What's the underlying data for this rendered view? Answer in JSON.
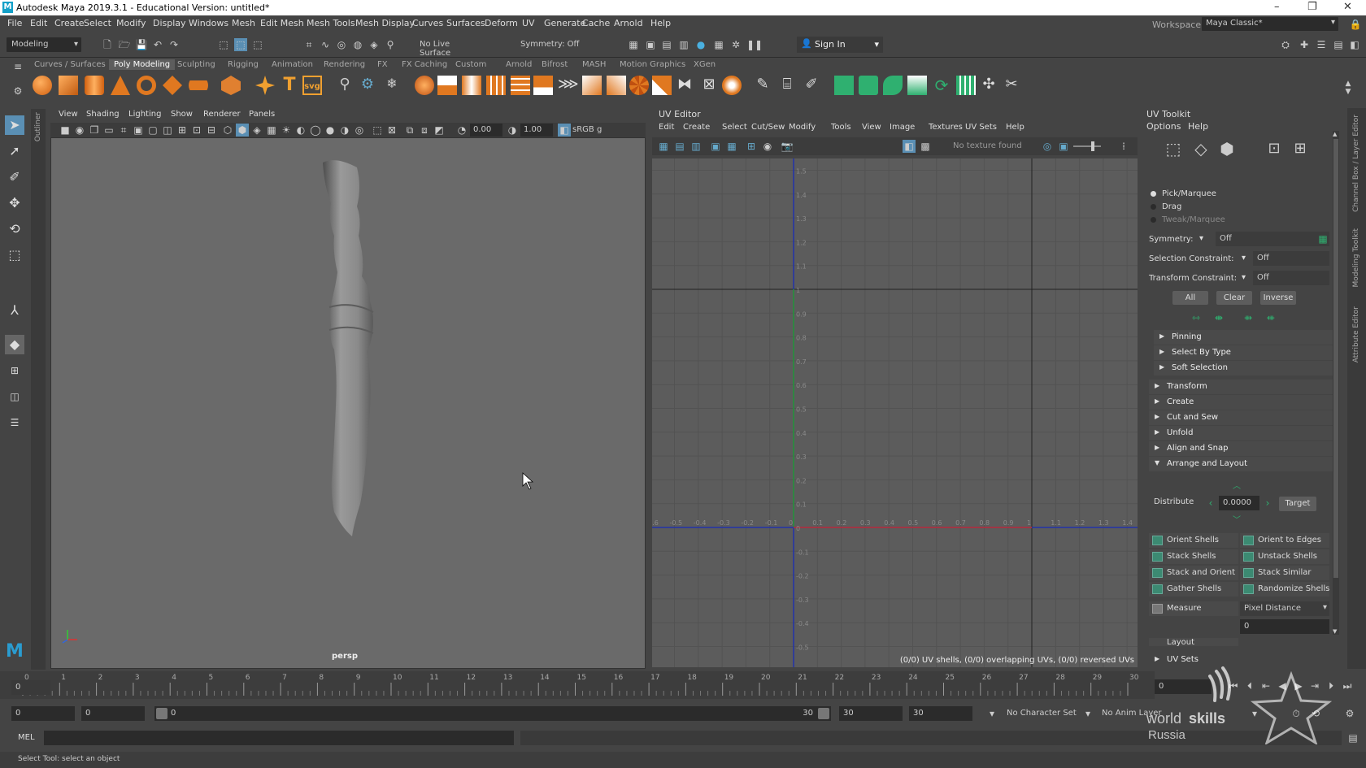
{
  "window": {
    "title": "Autodesk Maya 2019.3.1 - Educational Version: untitled*",
    "logo": "M"
  },
  "menubar": {
    "items": [
      "File",
      "Edit",
      "Create",
      "Select",
      "Modify",
      "Display",
      "Windows",
      "Mesh",
      "Edit Mesh",
      "Mesh Tools",
      "Mesh Display",
      "Curves",
      "Surfaces",
      "Deform",
      "UV",
      "Generate",
      "Cache",
      "Arnold",
      "Help"
    ],
    "workspace_label": "Workspace :",
    "workspace_value": "Maya Classic*"
  },
  "statusline": {
    "mode": "Modeling",
    "live_surface": "No Live Surface",
    "symmetry": "Symmetry: Off",
    "sign_in": "Sign In"
  },
  "shelf": {
    "tabs": [
      "Curves / Surfaces",
      "Poly Modeling",
      "Sculpting",
      "Rigging",
      "Animation",
      "Rendering",
      "FX",
      "FX Caching",
      "Custom",
      "Arnold",
      "Bifrost",
      "MASH",
      "Motion Graphics",
      "XGen"
    ],
    "active": "Poly Modeling"
  },
  "outliner_label": "Outliner",
  "viewport": {
    "menus": [
      "View",
      "Shading",
      "Lighting",
      "Show",
      "Renderer",
      "Panels"
    ],
    "field1": "0.00",
    "field2": "1.00",
    "colorspace": "sRGB g",
    "camera_label": "persp"
  },
  "uv_editor": {
    "title": "UV Editor",
    "menus": [
      "Edit",
      "Create",
      "Select",
      "Cut/Sew",
      "Modify",
      "Tools",
      "View",
      "Image",
      "Textures",
      "UV Sets",
      "Help"
    ],
    "texture_label": "No texture found",
    "y_labels": [
      "1.5",
      "1.4",
      "1.3",
      "1.2",
      "1.1",
      "1",
      "0.9",
      "0.8",
      "0.7",
      "0.6",
      "0.5",
      "0.4",
      "0.3",
      "0.2",
      "0.1",
      "0",
      "-0.1",
      "-0.2",
      "-0.3",
      "-0.4",
      "-0.5"
    ],
    "x_labels": [
      "-0.6",
      "-0.5",
      "-0.4",
      "-0.3",
      "-0.2",
      "-0.1",
      "0",
      "0.1",
      "0.2",
      "0.3",
      "0.4",
      "0.5",
      "0.6",
      "0.7",
      "0.8",
      "0.9",
      "1",
      "1.1",
      "1.2",
      "1.3",
      "1.4"
    ],
    "status": "(0/0) UV shells, (0/0) overlapping UVs, (0/0) reversed UVs"
  },
  "toolkit": {
    "title": "UV Toolkit",
    "menus": [
      "Options",
      "Help"
    ],
    "modes": [
      "Pick/Marquee",
      "Drag",
      "Tweak/Marquee"
    ],
    "symmetry_label": "Symmetry:",
    "symmetry_value": "Off",
    "selection_constraint_label": "Selection Constraint:",
    "selection_constraint_value": "Off",
    "transform_constraint_label": "Transform Constraint:",
    "transform_constraint_value": "Off",
    "buttons": [
      "All",
      "Clear",
      "Inverse"
    ],
    "subsections": [
      "Pinning",
      "Select By Type",
      "Soft Selection"
    ],
    "sections": [
      "Transform",
      "Create",
      "Cut and Sew",
      "Unfold",
      "Align and Snap",
      "Arrange and Layout"
    ],
    "distribute_label": "Distribute",
    "distribute_value": "0.0000",
    "target_label": "Target",
    "arrange": [
      "Orient Shells",
      "Orient to Edges",
      "Stack Shells",
      "Unstack Shells",
      "Stack and Orient",
      "Stack Similar",
      "Gather Shells",
      "Randomize Shells"
    ],
    "measure_label": "Measure",
    "measure_value": "Pixel Distance",
    "measure_result": "0",
    "layout_label": "Layout",
    "uv_sets_label": "UV Sets"
  },
  "side_tabs": [
    "Channel Box / Layer Editor",
    "Modeling Toolkit",
    "Attribute Editor"
  ],
  "timeline": {
    "ticks": [
      "0",
      "1",
      "2",
      "3",
      "4",
      "5",
      "6",
      "7",
      "8",
      "9",
      "10",
      "11",
      "12",
      "13",
      "14",
      "15",
      "16",
      "17",
      "18",
      "19",
      "20",
      "21",
      "22",
      "23",
      "24",
      "25",
      "26",
      "27",
      "28",
      "29",
      "30"
    ],
    "current": "0",
    "current_frame_field": "0"
  },
  "range": {
    "start": "0",
    "inner_start": "0",
    "slider_start": "0",
    "slider_end": "30",
    "end": "30",
    "outer_end": "30",
    "character_set": "No Character Set",
    "anim_layer": "No Anim Layer"
  },
  "cmdline": {
    "label": "MEL"
  },
  "helpline": {
    "text": "Select Tool: select an object"
  },
  "watermark": {
    "line1": "world",
    "line2": "skills",
    "line3": "Russia"
  }
}
